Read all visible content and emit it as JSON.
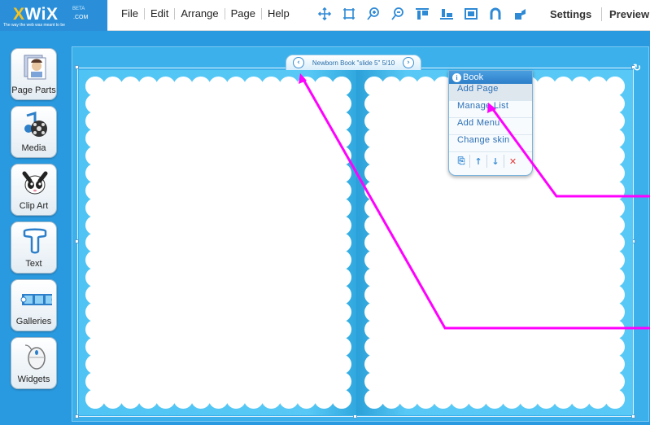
{
  "logo": {
    "wordmark_x": "X",
    "wordmark_rest": "WiX",
    "beta": "BETA",
    "com": ".COM",
    "tagline": "The way the web was meant to be"
  },
  "menu": [
    "File",
    "Edit",
    "Arrange",
    "Page",
    "Help"
  ],
  "tools": [
    "move-icon",
    "resize-icon",
    "zoom-in-icon",
    "zoom-out-icon",
    "align-top-icon",
    "align-bottom-icon",
    "frame-icon",
    "magnet-icon",
    "paint-icon"
  ],
  "settings_label": "Settings",
  "preview_label": "Preview",
  "sidebar": [
    {
      "label": "Page Parts",
      "icon": "page-parts-icon"
    },
    {
      "label": "Media",
      "icon": "media-icon"
    },
    {
      "label": "Clip Art",
      "icon": "clip-art-icon"
    },
    {
      "label": "Text",
      "icon": "text-icon"
    },
    {
      "label": "Galleries",
      "icon": "galleries-icon"
    },
    {
      "label": "Widgets",
      "icon": "widgets-icon"
    }
  ],
  "book_nav": {
    "title": "Newborn Book \"slide 5\" 5/10",
    "prev": "‹",
    "next": "›"
  },
  "book_popup": {
    "title": "Book",
    "items": [
      "Add Page",
      "Manage List",
      "Add Menu",
      "Change skin"
    ],
    "tools": [
      "⎘",
      "↑",
      "↓",
      "✕"
    ]
  },
  "colors": {
    "stage": "#3bb0ea",
    "page": "#58c8f5",
    "arrow": "#ff00ff",
    "menu_bg": "#ffffff"
  }
}
